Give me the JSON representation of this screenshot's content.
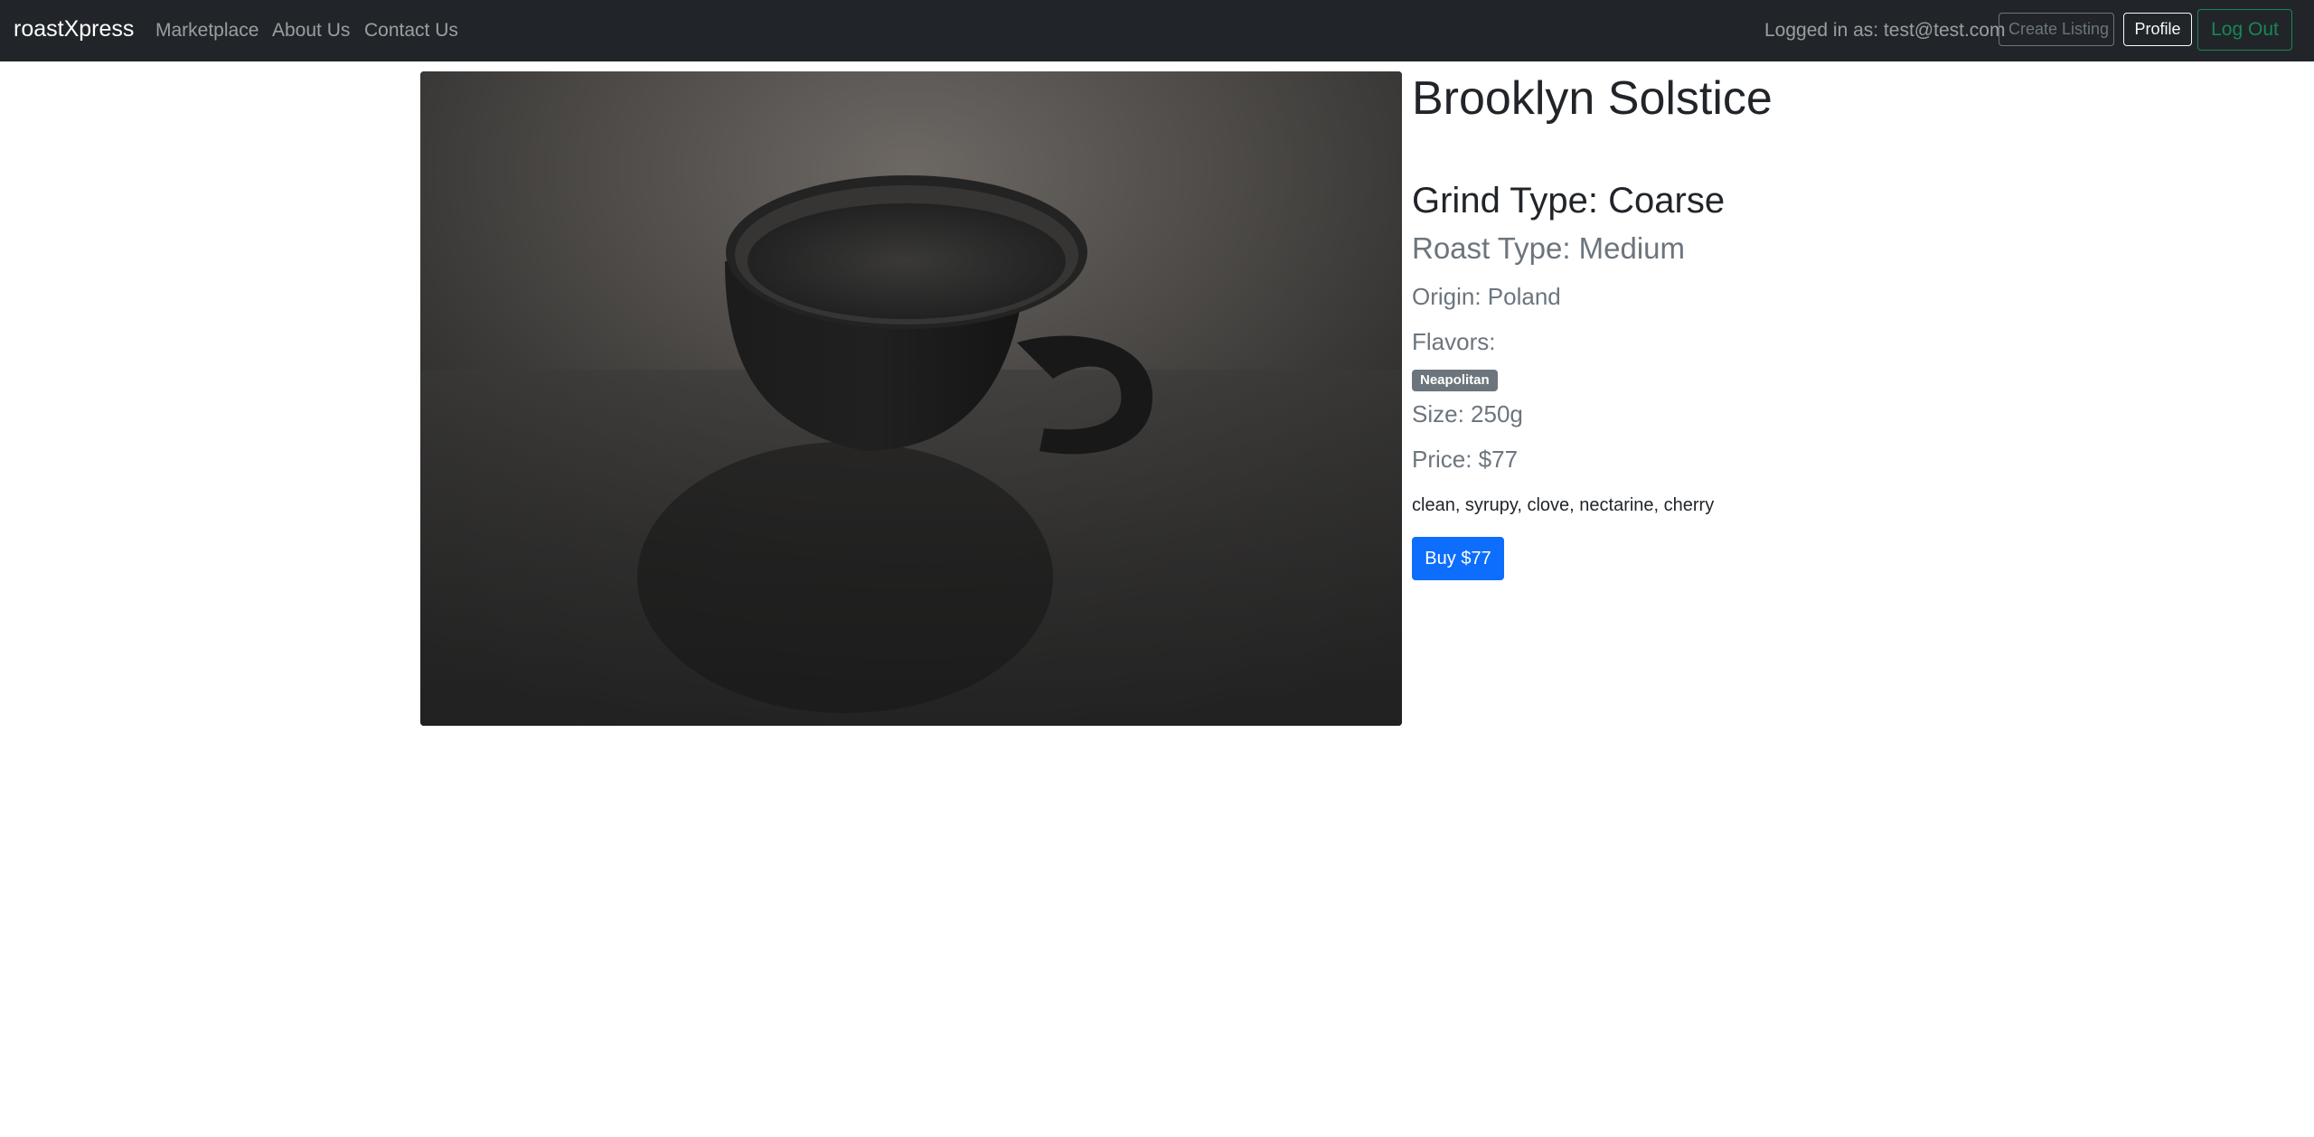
{
  "navbar": {
    "brand": "roastXpress",
    "links": [
      "Marketplace",
      "About Us",
      "Contact Us"
    ],
    "logged_in_text": "Logged in as: test@test.com",
    "create_listing_label": "Create Listing",
    "profile_label": "Profile",
    "logout_label": "Log Out"
  },
  "product": {
    "title": "Brooklyn Solstice",
    "grind": "Grind Type: Coarse",
    "roast": "Roast Type: Medium",
    "origin": "Origin: Poland",
    "flavors_label": "Flavors:",
    "flavor_badges": [
      "Neapolitan"
    ],
    "size": "Size: 250g",
    "price": "Price: $77",
    "description": "clean, syrupy, clove, nectarine, cherry",
    "buy_label": "Buy $77"
  },
  "colors": {
    "navbar_bg": "#212529",
    "buy_button": "#0d6efd",
    "logout_button": "#198754",
    "badge_bg": "#6c757d"
  }
}
